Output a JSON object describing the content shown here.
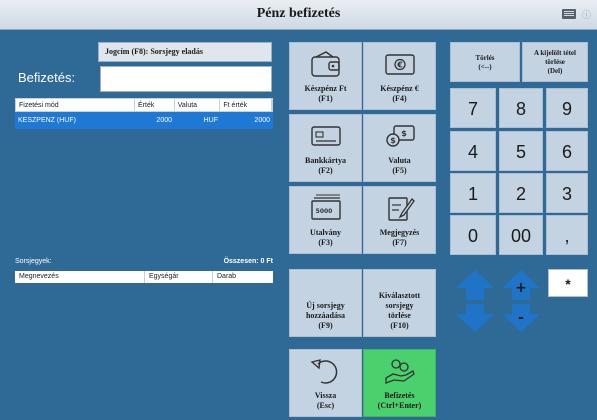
{
  "window": {
    "title": "Pénz befizetés"
  },
  "jogcim": "Jogcím (F8): Sorsjegy eladás",
  "befizetes": {
    "label": "Befizetés:",
    "value": ""
  },
  "payments": {
    "headers": [
      "Fizetési mód",
      "Érték",
      "Valuta",
      "Ft érték"
    ],
    "rows": [
      {
        "mode": "KÉSZPÉNZ (HUF)",
        "value": "2000",
        "currency": "HUF",
        "ft_value": "2000"
      }
    ]
  },
  "tickets": {
    "label": "Sorsjegyek:",
    "total": "Összesen: 0 Ft",
    "headers": [
      "Megnevezés",
      "Egységár",
      "Darab"
    ]
  },
  "buttons": {
    "cash_ft": {
      "line1": "Készpénz Ft",
      "line2": "(F1)"
    },
    "cash_eur": {
      "line1": "Készpénz €",
      "line2": "(F4)"
    },
    "card": {
      "line1": "Bankkártya",
      "line2": "(F2)"
    },
    "currency": {
      "line1": "Valuta",
      "line2": "(F5)"
    },
    "voucher": {
      "line1": "Utalvány",
      "line2": "(F3)"
    },
    "note": {
      "line1": "Megjegyzés",
      "line2": "(F7)"
    },
    "new_ticket": {
      "line1": "Új sorsjegy",
      "line2": "hozzáadása",
      "line3": "(F9)"
    },
    "delete_ticket": {
      "line1": "Kiválasztott",
      "line2": "sorsjegy",
      "line3": "törlése",
      "line4": "(F10)"
    },
    "back": {
      "line1": "Vissza",
      "line2": "(Esc)"
    },
    "pay": {
      "line1": "Befizetés",
      "line2": "(Ctrl+Enter)"
    }
  },
  "keypad": {
    "torles": {
      "line1": "Törlés",
      "line2": "(<--)"
    },
    "del_selected": {
      "line1": "A kijelölt tétel",
      "line2": "törlése",
      "line3": "(Del)"
    },
    "keys": [
      "7",
      "8",
      "9",
      "4",
      "5",
      "6",
      "1",
      "2",
      "3",
      "0",
      "00",
      ","
    ],
    "plus": "+",
    "minus": "-",
    "star": "*"
  },
  "colors": {
    "background": "#2f6a97",
    "button": "#c4d3e2",
    "selected_row": "#1e78d4",
    "pay_button": "#4ad06c",
    "arrow": "#1f74c8"
  }
}
